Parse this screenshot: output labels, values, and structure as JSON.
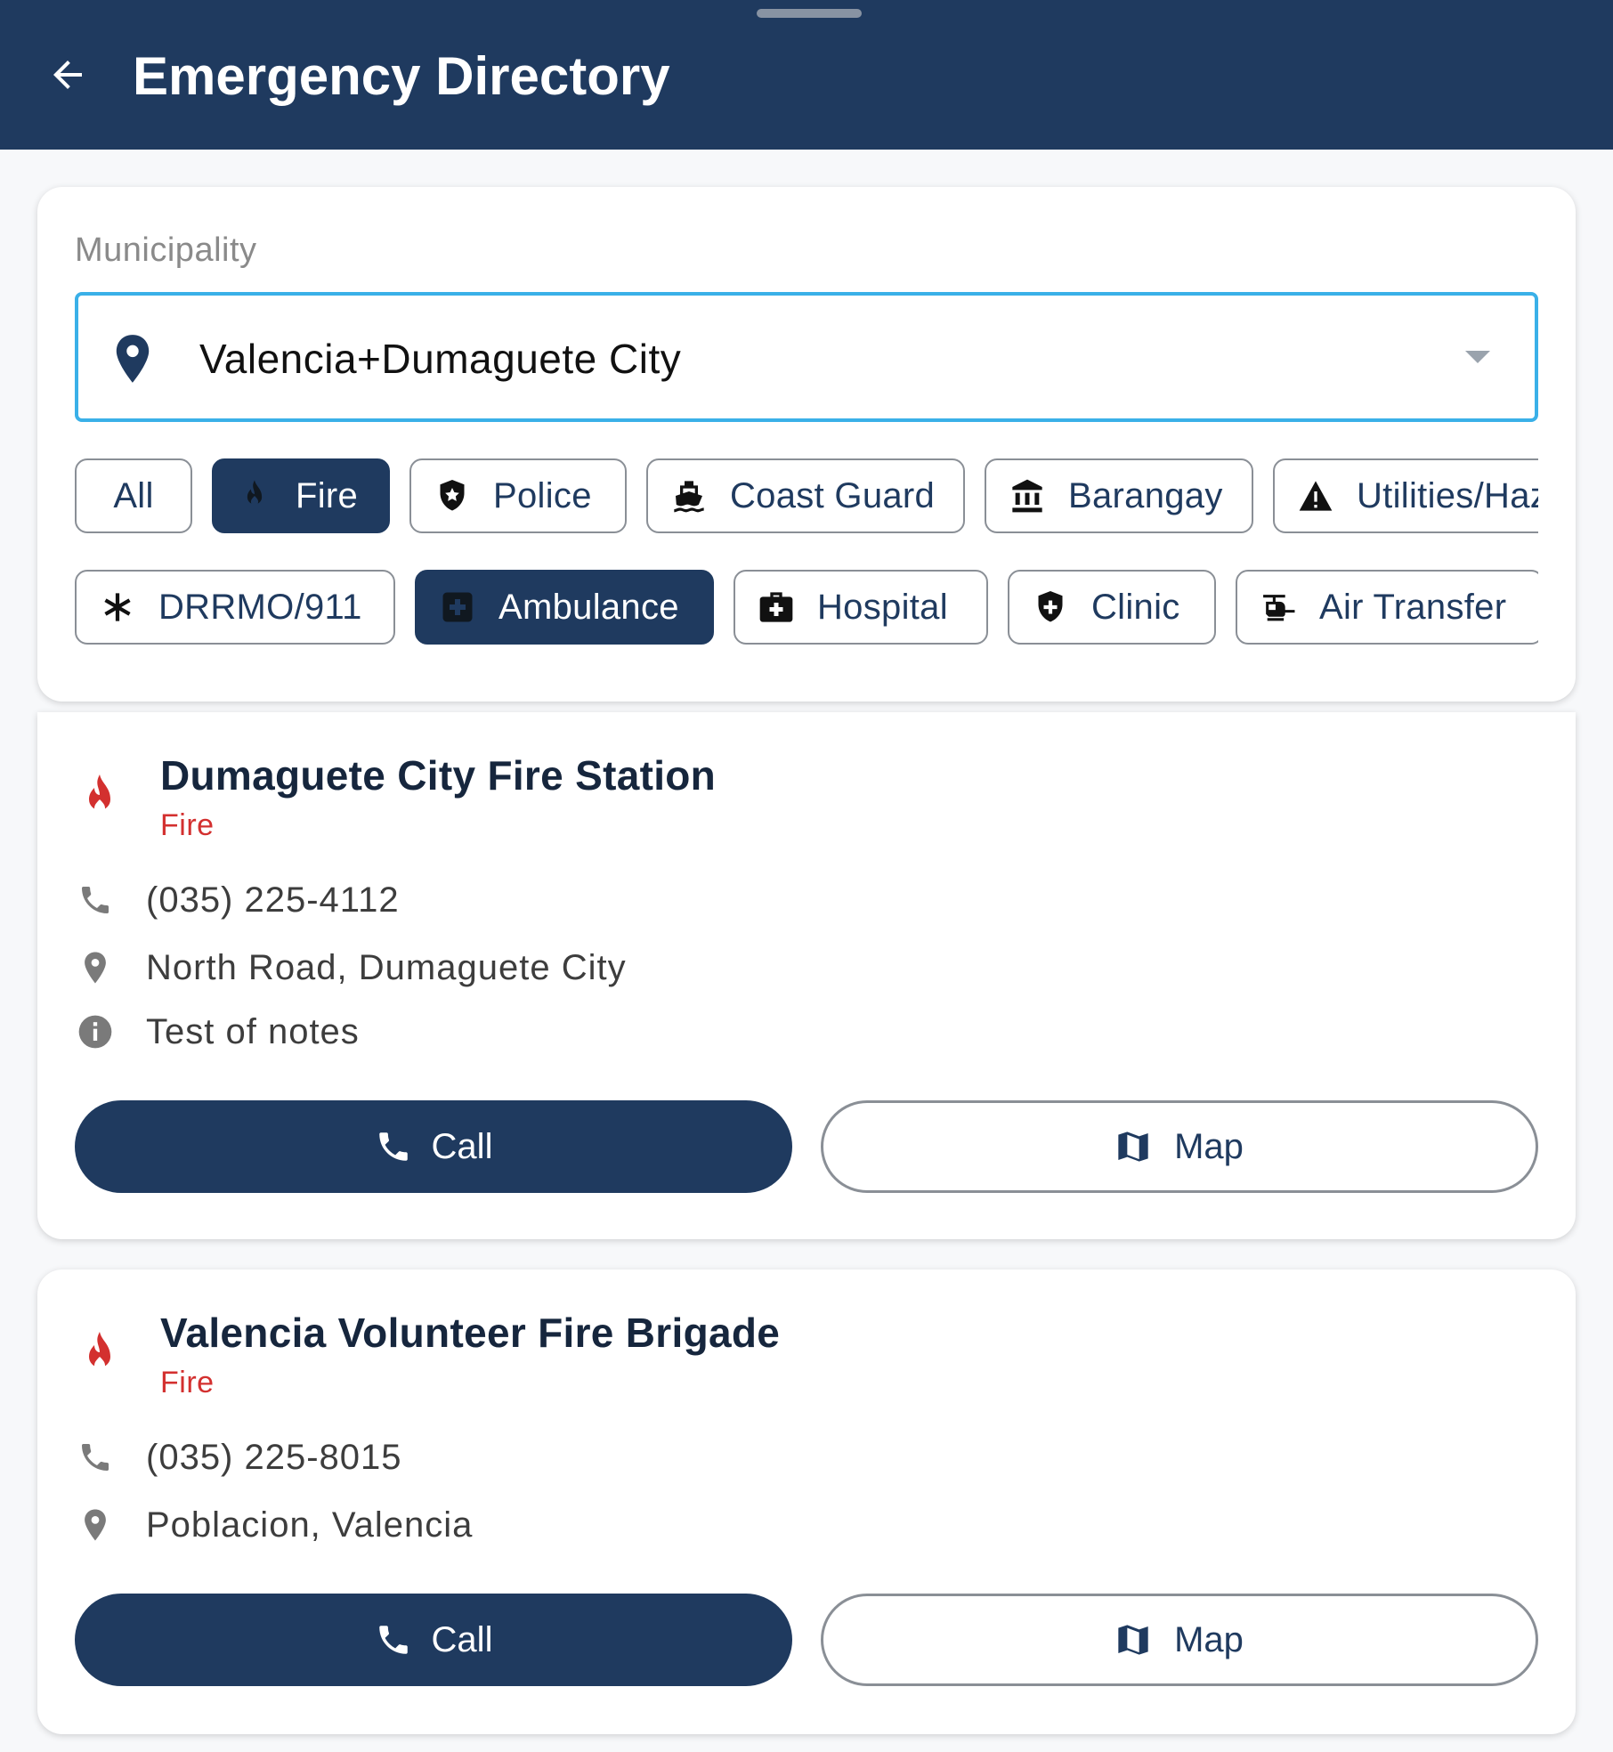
{
  "appbar": {
    "title": "Emergency Directory"
  },
  "filter": {
    "municipality_label": "Municipality",
    "municipality_value": "Valencia+Dumaguete City",
    "chips_row1": [
      {
        "label": "All",
        "icon": "none",
        "selected": false
      },
      {
        "label": "Fire",
        "icon": "fire-icon",
        "selected": true
      },
      {
        "label": "Police",
        "icon": "police-shield-icon",
        "selected": false
      },
      {
        "label": "Coast Guard",
        "icon": "ship-icon",
        "selected": false
      },
      {
        "label": "Barangay",
        "icon": "government-building-icon",
        "selected": false
      },
      {
        "label": "Utilities/Hazards",
        "icon": "warning-icon",
        "selected": false
      }
    ],
    "chips_row2": [
      {
        "label": "DRRMO/911",
        "icon": "asterisk-icon",
        "selected": false
      },
      {
        "label": "Ambulance",
        "icon": "medical-cross-icon",
        "selected": true
      },
      {
        "label": "Hospital",
        "icon": "medical-bag-icon",
        "selected": false
      },
      {
        "label": "Clinic",
        "icon": "medical-shield-icon",
        "selected": false
      },
      {
        "label": "Air Transfer",
        "icon": "helicopter-icon",
        "selected": false
      }
    ]
  },
  "entries": [
    {
      "name": "Dumaguete City Fire Station",
      "type": "Fire",
      "phone": "(035) 225-4112",
      "address": "North Road, Dumaguete City",
      "notes": "Test of notes",
      "call_label": "Call",
      "map_label": "Map"
    },
    {
      "name": "Valencia Volunteer Fire Brigade",
      "type": "Fire",
      "phone": "(035) 225-8015",
      "address": "Poblacion, Valencia",
      "call_label": "Call",
      "map_label": "Map"
    }
  ],
  "colors": {
    "primary": "#1f3a5f",
    "accent": "#3ab0e8",
    "fire_red": "#d3302f",
    "background": "#f7f8fa"
  }
}
